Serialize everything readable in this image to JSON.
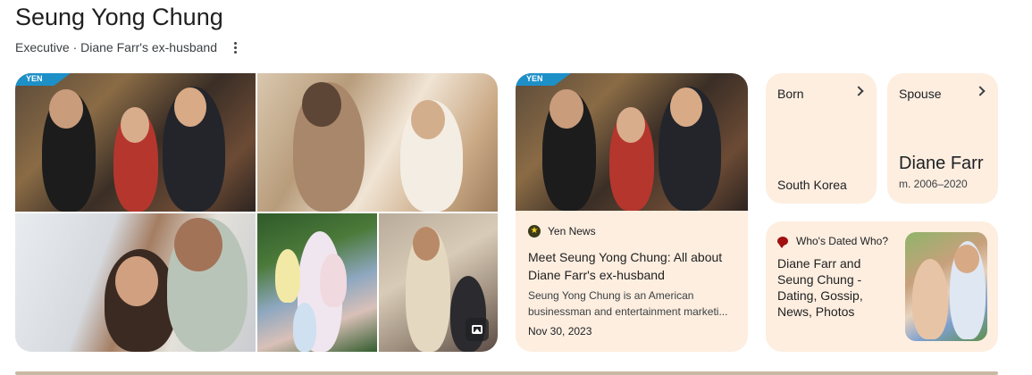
{
  "entity": {
    "name": "Seung Yong Chung",
    "description": "Executive · Diane Farr's ex-husband"
  },
  "photos": {
    "badge": "YEN"
  },
  "news": {
    "badge": "YEN",
    "source": "Yen News",
    "headline": "Meet Seung Yong Chung: All about Diane Farr's ex-husband",
    "snippet": "Seung Yong Chung is an American businessman and entertainment marketi...",
    "date": "Nov 30, 2023"
  },
  "facts": {
    "born": {
      "label": "Born",
      "value": "South Korea"
    },
    "spouse": {
      "label": "Spouse",
      "name": "Diane Farr",
      "detail": "m. 2006–2020"
    }
  },
  "dated": {
    "source": "Who's Dated Who?",
    "title": "Diane Farr and Seung Chung - Dating, Gossip, News, Photos"
  },
  "icons": {
    "more": "more-vert-icon",
    "gallery": "image-gallery-icon",
    "news_source": "star-icon",
    "chevron": "chevron-right-icon",
    "dated_source": "speech-bubble-icon"
  },
  "colors": {
    "card_bg": "#fdeee0",
    "yen_badge": "#1e90c8"
  }
}
